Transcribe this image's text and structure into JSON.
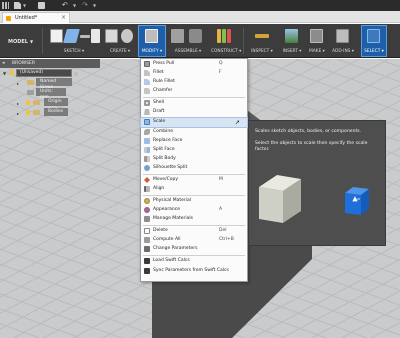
{
  "quick_bar": {
    "icons": [
      "apps-grid-icon",
      "file-icon",
      "save-icon",
      "undo-icon",
      "redo-icon"
    ],
    "undo_glyph": "↶",
    "redo_glyph": "↷"
  },
  "tab": {
    "title": "Untitled*",
    "close_glyph": "×"
  },
  "toolbar": {
    "workspace": "MODEL",
    "groups": [
      {
        "label": "SKETCH ▾"
      },
      {
        "label": "CREATE ▾"
      },
      {
        "label": "MODIFY ▾"
      },
      {
        "label": "ASSEMBLE ▾"
      },
      {
        "label": "CONSTRUCT ▾"
      },
      {
        "label": "INSPECT ▾"
      },
      {
        "label": "INSERT ▾"
      },
      {
        "label": "MAKE ▾"
      },
      {
        "label": "ADD-INS ▾"
      },
      {
        "label": "SELECT ▾"
      }
    ]
  },
  "browser": {
    "title": "BROWSER",
    "root": "(Unsaved)",
    "items": [
      "Named Views",
      "Units: mm",
      "Origin",
      "Bodies"
    ]
  },
  "modify_menu": {
    "items": [
      {
        "label": "Press Pull",
        "shortcut": "Q"
      },
      {
        "label": "Fillet",
        "shortcut": "F"
      },
      {
        "label": "Rule Fillet",
        "shortcut": ""
      },
      {
        "label": "Chamfer",
        "shortcut": ""
      },
      {
        "label": "Shell",
        "shortcut": ""
      },
      {
        "label": "Draft",
        "shortcut": ""
      },
      {
        "label": "Scale",
        "shortcut": ""
      },
      {
        "label": "Combine",
        "shortcut": ""
      },
      {
        "label": "Replace Face",
        "shortcut": ""
      },
      {
        "label": "Split Face",
        "shortcut": ""
      },
      {
        "label": "Split Body",
        "shortcut": ""
      },
      {
        "label": "Silhouette Split",
        "shortcut": ""
      },
      {
        "label": "Move/Copy",
        "shortcut": "M"
      },
      {
        "label": "Align",
        "shortcut": ""
      },
      {
        "label": "Physical Material",
        "shortcut": ""
      },
      {
        "label": "Appearance",
        "shortcut": "A"
      },
      {
        "label": "Manage Materials",
        "shortcut": ""
      },
      {
        "label": "Delete",
        "shortcut": "Del"
      },
      {
        "label": "Compute All",
        "shortcut": "Ctrl+B"
      },
      {
        "label": "Change Parameters",
        "shortcut": ""
      },
      {
        "label": "Load Swift Calcs",
        "shortcut": ""
      },
      {
        "label": "Sync Parameters from Swift Calcs",
        "shortcut": ""
      }
    ],
    "highlighted": "Scale"
  },
  "tooltip": {
    "title": "Scales sketch objects, bodies, or components.",
    "body": "Select the objects to scale then specify the scale factor."
  },
  "colors": {
    "toolbar_bg": "#3c3c3c",
    "active_group": "#1f5ea8",
    "canvas_bg": "#c9cbcc",
    "highlight": "#d6e4f3",
    "tooltip_bg": "#4e4e4e",
    "blue_cube": "#1e6fd9"
  }
}
